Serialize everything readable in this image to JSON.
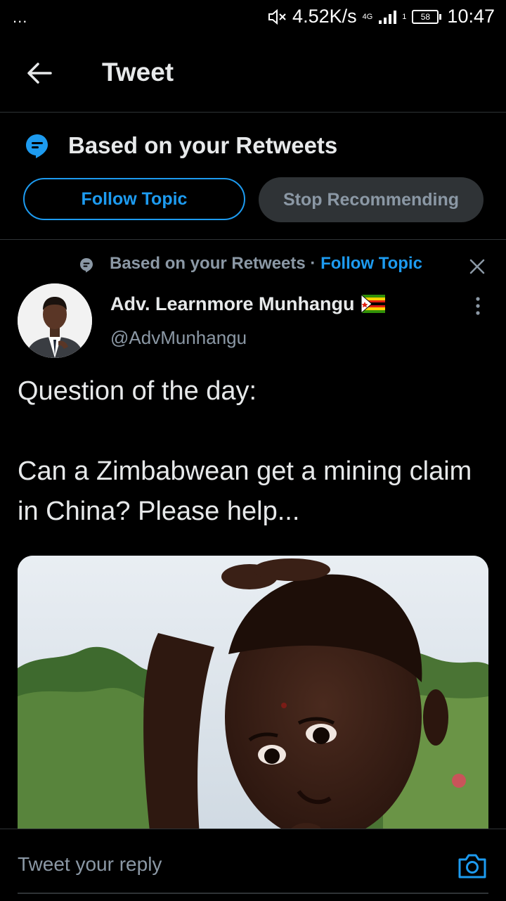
{
  "status_bar": {
    "dots": "...",
    "speed": "4.52K/s",
    "network": "4G",
    "sim": "1",
    "battery": "58",
    "time": "10:47"
  },
  "header": {
    "title": "Tweet"
  },
  "topic": {
    "heading": "Based on your Retweets",
    "follow_label": "Follow Topic",
    "stop_label": "Stop Recommending"
  },
  "tweet": {
    "context": "Based on your Retweets · ",
    "context_link": "Follow Topic",
    "author": "Adv. Learnmore Munhangu",
    "handle": "@AdvMunhangu",
    "text_line1": "Question of the day:",
    "text_line2": "Can a Zimbabwean get a mining claim in China? Please help..."
  },
  "reply": {
    "placeholder": "Tweet your reply"
  },
  "colors": {
    "accent": "#1d9bf0",
    "secondary_text": "#8b98a5",
    "background": "#000000"
  },
  "icons": [
    "back-arrow-icon",
    "topic-icon",
    "close-icon",
    "more-icon",
    "zimbabwe-flag-icon",
    "camera-icon",
    "mute-icon"
  ]
}
